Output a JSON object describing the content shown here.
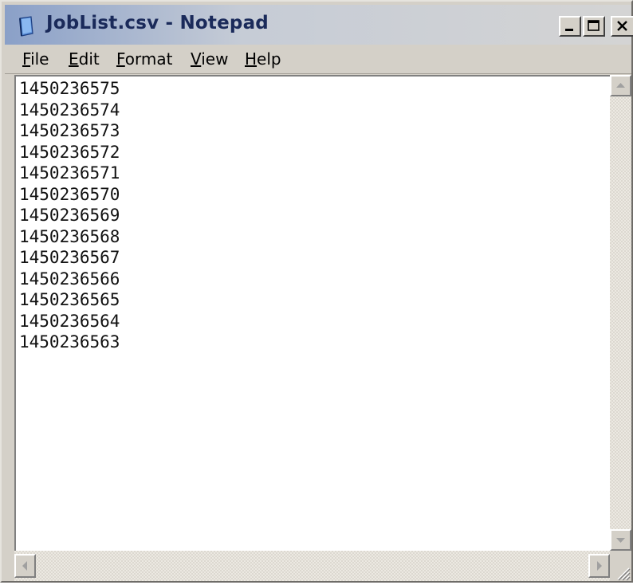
{
  "window": {
    "title": "JobList.csv - Notepad"
  },
  "menu": {
    "file": "File",
    "edit": "Edit",
    "format": "Format",
    "view": "View",
    "help": "Help"
  },
  "content": {
    "lines": [
      "1450236575",
      "1450236574",
      "1450236573",
      "1450236572",
      "1450236571",
      "1450236570",
      "1450236569",
      "1450236568",
      "1450236567",
      "1450236566",
      "1450236565",
      "1450236564",
      "1450236563"
    ]
  },
  "icons": {
    "app": "notepad-icon",
    "minimize": "minimize-icon",
    "maximize": "maximize-icon",
    "close": "close-icon",
    "scroll_up": "arrow-up-icon",
    "scroll_down": "arrow-down-icon",
    "scroll_left": "arrow-left-icon",
    "scroll_right": "arrow-right-icon",
    "resize_grip": "resize-grip-icon"
  },
  "colors": {
    "titlebar_start": "#8aa0c8",
    "titlebar_end": "#d4d4d4",
    "title_text": "#1a2a5a",
    "chrome": "#d4d0c8",
    "edit_background": "#ffffff"
  }
}
